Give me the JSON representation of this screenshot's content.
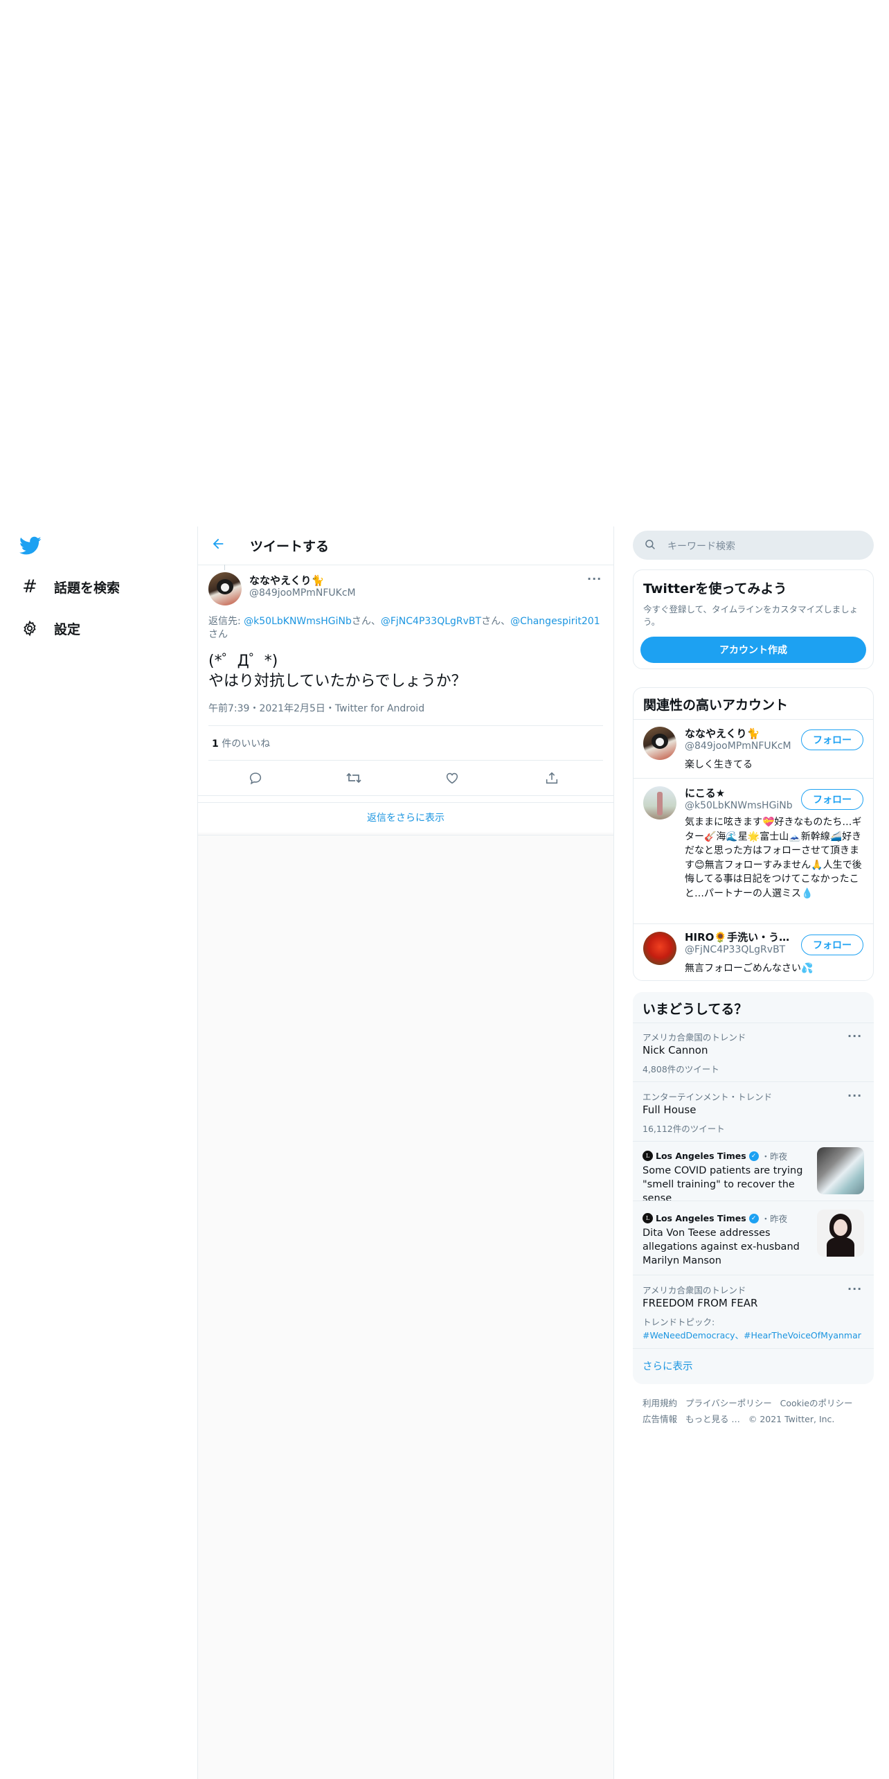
{
  "nav": {
    "explore_label": "話題を検索",
    "settings_label": "設定"
  },
  "header": {
    "title": "ツイートする"
  },
  "tweet": {
    "author_name": "ななやえくり🐈",
    "author_handle": "@849jooMPmNFUKcM",
    "reply_prefix": "返信先: ",
    "reply_to": [
      "@k50LbKNWmsHGiNb",
      "@FjNC4P33QLgRvBT",
      "@Changespirit201"
    ],
    "reply_suffix": "さん",
    "reply_sep": "さん、",
    "text_line1": "(*゜Д゜*)",
    "text_line2": "やはり対抗していたからでしょうか？",
    "meta": "午前7:39・2021年2月5日・Twitter for Android",
    "likes_count": "1",
    "likes_label": "件のいいね",
    "show_more_replies": "返信をさらに表示"
  },
  "search": {
    "placeholder": "キーワード検索"
  },
  "signup": {
    "title": "Twitterを使ってみよう",
    "desc": "今すぐ登録して、タイムラインをカスタマイズしましょう。",
    "button": "アカウント作成"
  },
  "related": {
    "title": "関連性の高いアカウント",
    "follow_label": "フォロー",
    "accounts": [
      {
        "name": "ななやえくり🐈",
        "handle": "@849jooMPmNFUKcM",
        "bio": "楽しく生きてる"
      },
      {
        "name": "にこる★",
        "handle": "@k50LbKNWmsHGiNb",
        "bio": "気ままに呟きます💝好きなものたち…ギター🎸海🌊星🌟富士山🗻新幹線🚄好きだなと思った方はフォローさせて頂きます😊無言フォローすみません🙏人生で後悔してる事は日記をつけてこなかったこと…パートナーの人選ミス💧"
      },
      {
        "name": "HIRO🌻手洗い・う…",
        "handle": "@FjNC4P33QLgRvBT",
        "bio": "無言フォローごめんなさい💦"
      }
    ]
  },
  "trends": {
    "title": "いまどうしてる？",
    "items": [
      {
        "context": "アメリカ合衆国のトレンド",
        "name": "Nick Cannon",
        "count": "4,808件のツイート"
      },
      {
        "context": "エンターテインメント・トレンド",
        "name": "Full House",
        "count": "16,112件のツイート"
      }
    ],
    "news": [
      {
        "source": "Los Angeles Times",
        "time": "・昨夜",
        "headline": "Some COVID patients are trying \"smell training\" to recover the sense"
      },
      {
        "source": "Los Angeles Times",
        "time": "・昨夜",
        "headline": "Dita Von Teese addresses allegations against ex-husband Marilyn Manson"
      }
    ],
    "last": {
      "context": "アメリカ合衆国のトレンド",
      "name": "FREEDOM FROM FEAR",
      "topic_label": "トレンドトピック:",
      "topics": "#WeNeedDemocracy、#HearTheVoiceOfMyanmar"
    },
    "show_more": "さらに表示"
  },
  "footer": {
    "links": [
      "利用規約",
      "プライバシーポリシー",
      "Cookieのポリシー",
      "広告情報",
      "もっと見る …"
    ],
    "copyright": "© 2021 Twitter, Inc."
  },
  "colors": {
    "accent": "#1da1f2",
    "link": "#1b95e0",
    "secondary_text": "#657786",
    "border": "#e6ecf0",
    "panel_bg": "#f5f8fa"
  }
}
